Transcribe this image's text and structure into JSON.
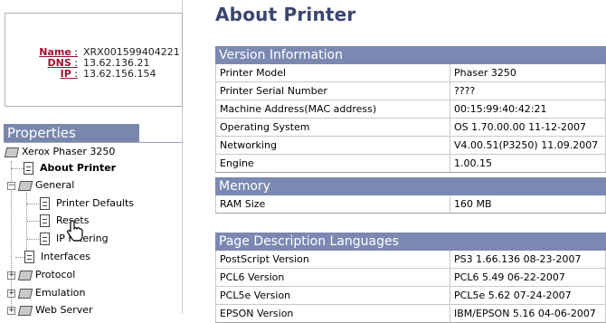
{
  "device_info": {
    "name_label": "Name",
    "name_value": "XRX001599404221",
    "dns_label": "DNS",
    "dns_value": "13.62.136.21",
    "ip_label": "IP",
    "ip_value": "13.62.156.154"
  },
  "sidebar": {
    "title": "Properties",
    "root": "Xerox Phaser 3250",
    "items": [
      {
        "label": "About Printer"
      },
      {
        "label": "General"
      },
      {
        "label": "Printer Defaults"
      },
      {
        "label": "Resets"
      },
      {
        "label": "IP Filtering"
      },
      {
        "label": "Interfaces"
      },
      {
        "label": "Protocol"
      },
      {
        "label": "Emulation"
      },
      {
        "label": "Web Server"
      }
    ]
  },
  "page": {
    "title": "About Printer"
  },
  "sections": [
    {
      "title": "Version Information",
      "rows": [
        {
          "key": "Printer Model",
          "value": "Phaser 3250"
        },
        {
          "key": "Printer Serial Number",
          "value": "????"
        },
        {
          "key": "Machine Address(MAC address)",
          "value": "00:15:99:40:42:21"
        },
        {
          "key": "Operating System",
          "value": "OS 1.70.00.00 11-12-2007"
        },
        {
          "key": "Networking",
          "value": "V4.00.51(P3250) 11.09.2007"
        },
        {
          "key": "Engine",
          "value": "1.00.15"
        }
      ]
    },
    {
      "title": "Memory",
      "rows": [
        {
          "key": "RAM Size",
          "value": "160 MB"
        }
      ]
    },
    {
      "title": "Page Description Languages",
      "rows": [
        {
          "key": "PostScript Version",
          "value": "PS3 1.66.136 08-23-2007"
        },
        {
          "key": "PCL6 Version",
          "value": "PCL6 5.49 06-22-2007"
        },
        {
          "key": "PCL5e Version",
          "value": "PCL5e 5.62 07-24-2007"
        },
        {
          "key": "EPSON Version",
          "value": "IBM/EPSON 5.16 04-06-2007"
        }
      ]
    }
  ],
  "colors": {
    "section_header": "#7b89b2",
    "title": "#3a4570",
    "info_label": "#a01030"
  }
}
